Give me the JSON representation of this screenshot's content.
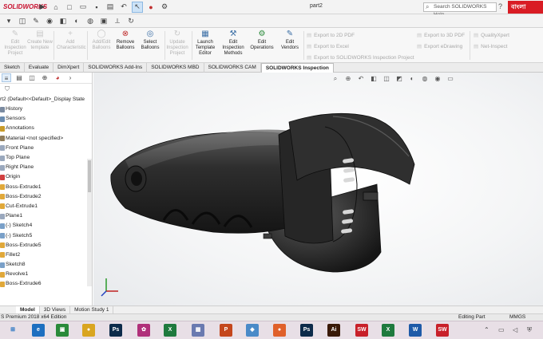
{
  "app": {
    "logo": "SOLIDWORKS",
    "document_title": "part2",
    "search_placeholder": "Search SOLIDWORKS Help",
    "language_badge": "বাংলা"
  },
  "ribbon": {
    "buttons": [
      {
        "label": "Edit Inspection Project",
        "enabled": false,
        "icon": "edit-icon"
      },
      {
        "label": "Create New template",
        "enabled": false,
        "icon": "template-icon"
      },
      {
        "label": "Add Characteristic",
        "enabled": false,
        "icon": "add-icon"
      },
      {
        "label": "Add/Edit Balloons",
        "enabled": false,
        "icon": "balloon-icon"
      },
      {
        "label": "Remove Balloons",
        "enabled": true,
        "icon": "remove-icon"
      },
      {
        "label": "Select Balloons",
        "enabled": true,
        "icon": "select-icon"
      },
      {
        "label": "Update Inspection Project",
        "enabled": false,
        "icon": "update-icon"
      },
      {
        "label": "Launch Template Editor",
        "enabled": true,
        "icon": "launch-icon"
      },
      {
        "label": "Edit Inspection Methods",
        "enabled": true,
        "icon": "methods-icon"
      },
      {
        "label": "Edit Operations",
        "enabled": true,
        "icon": "operations-icon"
      },
      {
        "label": "Edit Vendors",
        "enabled": true,
        "icon": "vendors-icon"
      }
    ],
    "exports": {
      "export_2d_pdf": "Export to 2D PDF",
      "export_excel": "Export to Excel",
      "export_sw_inspection": "Export to SOLIDWORKS Inspection Project",
      "export_3d_pdf": "Export to 3D PDF",
      "export_edrawing": "Export eDrawing",
      "quality_xpert": "QualityXpert",
      "net_inspect": "Net-Inspect"
    }
  },
  "command_tabs": [
    {
      "label": "Sketch",
      "active": false
    },
    {
      "label": "Evaluate",
      "active": false
    },
    {
      "label": "DimXpert",
      "active": false
    },
    {
      "label": "SOLIDWORKS Add-Ins",
      "active": false
    },
    {
      "label": "SOLIDWORKS MBD",
      "active": false
    },
    {
      "label": "SOLIDWORKS CAM",
      "active": false
    },
    {
      "label": "SOLIDWORKS Inspection",
      "active": true
    }
  ],
  "feature_tree": {
    "root": "rt2  (Default<<Default>_Display State",
    "items": [
      {
        "label": "History",
        "icon": "history-icon",
        "color": "#7a8aa0"
      },
      {
        "label": "Sensors",
        "icon": "sensor-icon",
        "color": "#6a8cb0"
      },
      {
        "label": "Annotations",
        "icon": "annotation-icon",
        "color": "#c89b2a"
      },
      {
        "label": "Material <not specified>",
        "icon": "material-icon",
        "color": "#8f7c5a"
      },
      {
        "label": "Front Plane",
        "icon": "plane-icon",
        "color": "#9aa8bd"
      },
      {
        "label": "Top Plane",
        "icon": "plane-icon",
        "color": "#9aa8bd"
      },
      {
        "label": "Right Plane",
        "icon": "plane-icon",
        "color": "#9aa8bd"
      },
      {
        "label": "Origin",
        "icon": "origin-icon",
        "color": "#d04040"
      },
      {
        "label": "Boss-Extrude1",
        "icon": "extrude-icon",
        "color": "#e0a83a"
      },
      {
        "label": "Boss-Extrude2",
        "icon": "extrude-icon",
        "color": "#e0a83a"
      },
      {
        "label": "Cut-Extrude1",
        "icon": "cut-icon",
        "color": "#e0a83a"
      },
      {
        "label": "Plane1",
        "icon": "plane-icon",
        "color": "#9aa8bd"
      },
      {
        "label": "(-) Sketch4",
        "icon": "sketch-icon",
        "color": "#7aa0c8"
      },
      {
        "label": "(-) Sketch5",
        "icon": "sketch-icon",
        "color": "#7aa0c8"
      },
      {
        "label": "Boss-Extrude5",
        "icon": "extrude-icon",
        "color": "#e0a83a"
      },
      {
        "label": "Fillet2",
        "icon": "fillet-icon",
        "color": "#e0a83a"
      },
      {
        "label": "Sketch8",
        "icon": "sketch-icon",
        "color": "#7aa0c8"
      },
      {
        "label": "Revolve1",
        "icon": "revolve-icon",
        "color": "#e0a83a"
      },
      {
        "label": "Boss-Extrude6",
        "icon": "extrude-icon",
        "color": "#e0a83a"
      }
    ]
  },
  "bottom_tabs": [
    {
      "label": "Model",
      "active": true
    },
    {
      "label": "3D Views",
      "active": false
    },
    {
      "label": "Motion Study 1",
      "active": false
    }
  ],
  "status": {
    "product": "S Premium 2018 x64 Edition",
    "mode": "Editing Part",
    "units": "MMGS"
  },
  "taskbar": {
    "apps": [
      {
        "name": "edge-icon",
        "label": "e",
        "color": "#1e6fc0"
      },
      {
        "name": "store-icon",
        "label": "▣",
        "color": "#2a8a3a"
      },
      {
        "name": "chrome-icon",
        "label": "●",
        "color": "#d9a520"
      },
      {
        "name": "photoshop-icon",
        "label": "Ps",
        "color": "#0d2b4a"
      },
      {
        "name": "app-icon",
        "label": "✿",
        "color": "#b0307a"
      },
      {
        "name": "excel-icon-1",
        "label": "X",
        "color": "#1f7a3e"
      },
      {
        "name": "app2-icon",
        "label": "▦",
        "color": "#6a7ab0"
      },
      {
        "name": "powerpoint-icon",
        "label": "P",
        "color": "#c4461c"
      },
      {
        "name": "app3-icon",
        "label": "◆",
        "color": "#4a8ac8"
      },
      {
        "name": "firefox-icon",
        "label": "●",
        "color": "#e0602a"
      },
      {
        "name": "photoshop2-icon",
        "label": "Ps",
        "color": "#0d2b4a"
      },
      {
        "name": "illustrator-icon",
        "label": "Ai",
        "color": "#3a1a08"
      },
      {
        "name": "solidworks-2018-icon",
        "label": "SW",
        "color": "#c8202a"
      },
      {
        "name": "excel-icon-2",
        "label": "X",
        "color": "#1f7a3e"
      },
      {
        "name": "word-icon",
        "label": "W",
        "color": "#1e5aa8"
      },
      {
        "name": "solidworks-2018b-icon",
        "label": "SW",
        "color": "#c8202a"
      }
    ]
  }
}
